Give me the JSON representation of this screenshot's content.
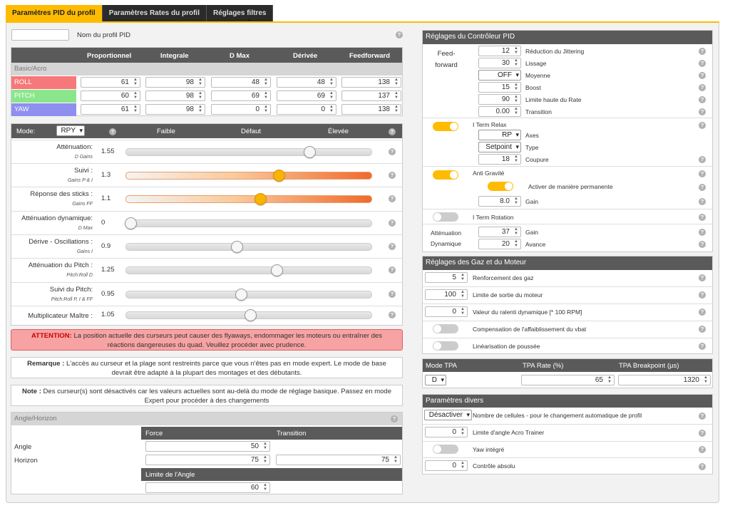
{
  "tabs": [
    "Paramètres PID du profil",
    "Paramètres Rates du profil",
    "Réglages filtres"
  ],
  "profile_name_label": "Nom du profil PID",
  "pid_table": {
    "headers": [
      "Proportionnel",
      "Integrale",
      "D Max",
      "Dérivée",
      "Feedforward"
    ],
    "section": "Basic/Acro",
    "rows": [
      {
        "name": "ROLL",
        "color": "#f7787a",
        "values": [
          "61",
          "98",
          "48",
          "48",
          "138"
        ]
      },
      {
        "name": "PITCH",
        "color": "#8be68b",
        "values": [
          "60",
          "98",
          "69",
          "69",
          "137"
        ]
      },
      {
        "name": "YAW",
        "color": "#8f8fef",
        "values": [
          "61",
          "98",
          "0",
          "0",
          "138"
        ]
      }
    ]
  },
  "sliders": {
    "mode_label": "Mode:",
    "mode_value": "RPY",
    "col_low": "Faible",
    "col_default": "Défaut",
    "col_high": "Élevée",
    "items": [
      {
        "label": "Atténuation:",
        "sub": "D Gains",
        "value": "1.55",
        "pos": 0.76,
        "active": false
      },
      {
        "label": "Suivi :",
        "sub": "Gains P & I",
        "value": "1.3",
        "pos": 0.63,
        "active": true
      },
      {
        "label": "Réponse des sticks :",
        "sub": "Gains FF",
        "value": "1.1",
        "pos": 0.55,
        "active": true
      },
      {
        "label": "Atténuation dynamique:",
        "sub": "D Max",
        "value": "0",
        "pos": 0.0,
        "active": false
      },
      {
        "label": "Dérive - Oscillations :",
        "sub": "Gains I",
        "value": "0.9",
        "pos": 0.45,
        "active": false
      },
      {
        "label": "Atténuation du Pitch :",
        "sub": "Pitch:Roll D",
        "value": "1.25",
        "pos": 0.62,
        "active": false
      },
      {
        "label": "Suivi du Pitch:",
        "sub": "Pitch:Roll P, I & FF",
        "value": "0.95",
        "pos": 0.47,
        "active": false
      },
      {
        "label": "Multiplicateur Maître :",
        "sub": "",
        "value": "1.05",
        "pos": 0.51,
        "active": false
      }
    ]
  },
  "warning_label": "ATTENTION:",
  "warning": "La position actuelle des curseurs peut causer des flyaways, endommager les moteurs ou entraîner des réactions dangereuses du quad. Veuillez procéder avec prudence.",
  "remark_label": "Remarque :",
  "remark": "L'accès au curseur et la plage sont restreints parce que vous n'êtes pas en mode expert. Le mode de base devrait être adapté à la plupart des montages et des débutants.",
  "note_label": "Note :",
  "note": "Des curseur(s) sont désactivés car les valeurs actuelles sont au-delà du mode de réglage basique. Passez en mode Expert pour procéder à des changements",
  "angle": {
    "title": "Angle/Horizon",
    "col_force": "Force",
    "col_transition": "Transition",
    "angle_label": "Angle",
    "angle_force": "50",
    "horizon_label": "Horizon",
    "horizon_force": "75",
    "horizon_transition": "75",
    "limit_label": "Limite de l'Angle",
    "limit_value": "60"
  },
  "pid_ctrl": {
    "title": "Réglages du Contrôleur PID",
    "ff_label": "Feed-forward",
    "ff_items": [
      {
        "label": "Réduction du Jittering",
        "value": "12"
      },
      {
        "label": "Lissage",
        "value": "30"
      },
      {
        "label": "Moyenne",
        "value": "OFF"
      },
      {
        "label": "Boost",
        "value": "15"
      },
      {
        "label": "Limite haute du Rate",
        "value": "90"
      },
      {
        "label": "Transition",
        "value": "0.00"
      }
    ],
    "iterm_relax": "I Term Relax",
    "axes_label": "Axes",
    "axes_value": "RP",
    "type_label": "Type",
    "type_value": "Setpoint",
    "cutoff_label": "Coupure",
    "cutoff_value": "18",
    "anti_gravity": "Anti Gravité",
    "ag_permanent": "Activer de manière permanente",
    "gain_label": "Gain",
    "ag_gain": "8.0",
    "iterm_rotation": "I Term Rotation",
    "dyn_att_label": "Atténuation Dynamique",
    "dyn_gain_label": "Gain",
    "dyn_gain": "37",
    "dyn_advance_label": "Avance",
    "dyn_advance": "20"
  },
  "throttle": {
    "title": "Réglages des Gaz et du Moteur",
    "items": [
      {
        "label": "Renforcement des gaz",
        "value": "5"
      },
      {
        "label": "Limite de sortie du moteur",
        "value": "100"
      },
      {
        "label": "Valeur du ralenti dynamique [* 100 RPM]",
        "value": "0"
      },
      {
        "label": "Compensation de l'affaiblissement du vbat",
        "toggle": true
      },
      {
        "label": "Linéarisation de poussée",
        "toggle": true
      }
    ]
  },
  "tpa": {
    "mode_label": "Mode TPA",
    "rate_label": "TPA Rate (%)",
    "breakpoint_label": "TPA Breakpoint (µs)",
    "mode_value": "D",
    "rate": "65",
    "breakpoint": "1320"
  },
  "misc": {
    "title": "Paramètres divers",
    "cells_label": "Nombre de cellules - pour le changement automatique de profil",
    "cells_value": "Désactiver",
    "acro_label": "Limite d'angle Acro Trainer",
    "acro_value": "0",
    "yaw_label": "Yaw intégré",
    "abs_label": "Contrôle absolu",
    "abs_value": "0"
  }
}
